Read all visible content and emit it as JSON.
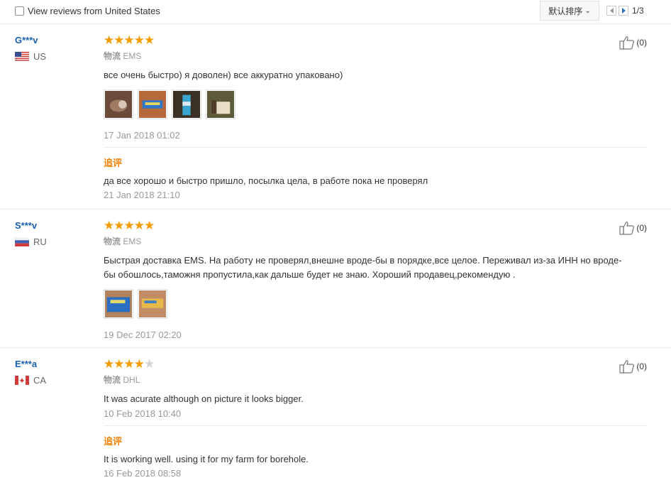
{
  "filter": {
    "label": "View reviews from United States",
    "checked": false
  },
  "sort": {
    "label": "默认排序"
  },
  "pagination": {
    "current_total": "1/3"
  },
  "colors": {
    "username": "#1a5eae",
    "star": "#f59b00",
    "append_label": "#f08200",
    "meta": "#999999"
  },
  "reviews": [
    {
      "user": "G***v",
      "country": "US",
      "flag_icon": "us-flag-icon",
      "rating": 5,
      "logistics_label": "物流",
      "logistics_value": "EMS",
      "text": "все очень быстро) я доволен) все аккуратно упаковано)",
      "photos": 4,
      "date": "17 Jan 2018 01:02",
      "append_label": "追评",
      "append_text": "да все хорошо и быстро пришло, посылка цела, в работе пока не проверял",
      "append_date": "21 Jan 2018 21:10",
      "helpful": "(0)"
    },
    {
      "user": "S***v",
      "country": "RU",
      "flag_icon": "ru-flag-icon",
      "rating": 5,
      "logistics_label": "物流",
      "logistics_value": "EMS",
      "text_line1": "Быстрая доставка EMS. На работу не проверял,внешне вроде-бы в порядке,все целое. Переживал из-за ИНН но вроде-",
      "text_line2": "бы обошлось,таможня пропустила,как дальше будет не знаю. Хороший продавец,рекомендую .",
      "photos": 2,
      "date": "19 Dec 2017 02:20",
      "helpful": "(0)"
    },
    {
      "user": "E***a",
      "country": "CA",
      "flag_icon": "ca-flag-icon",
      "rating": 4,
      "logistics_label": "物流",
      "logistics_value": "DHL",
      "text": "It was acurate although on picture it looks bigger.",
      "date": "10 Feb 2018 10:40",
      "append_label": "追评",
      "append_text": "It is working well. using it for my farm for borehole.",
      "append_date": "16 Feb 2018 08:58",
      "helpful": "(0)"
    }
  ]
}
